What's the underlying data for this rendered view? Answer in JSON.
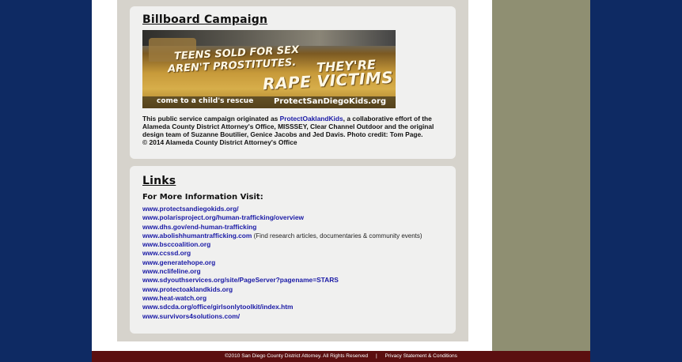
{
  "billboard": {
    "title": "Billboard Campaign",
    "image_text": {
      "line1": "TEENS SOLD FOR SEX",
      "line2": "AREN'T PROSTITUTES.",
      "line3": "THEY'RE",
      "line4": "RAPE VICTIMS",
      "strip_left": "come to a child's rescue",
      "strip_right": "ProtectSanDiegoKids.org"
    },
    "caption_prefix": "This public service campaign originated as ",
    "caption_link": "ProtectOaklandKids",
    "caption_suffix": ", a collaborative effort of the Alameda County District Attorney's Office, MISSSEY, Clear Channel Outdoor and the original design team of Suzanne Boutilier, Genice Jacobs and Jed Davis. Photo credit: Tom Page.",
    "caption_copyright": "© 2014 Alameda County District Attorney's Office"
  },
  "links": {
    "title": "Links",
    "subhead": "For More Information Visit:",
    "items": [
      {
        "label": "www.protectsandiegokids.org/"
      },
      {
        "label": "www.polarisproject.org/human-trafficking/overview"
      },
      {
        "label": "www.dhs.gov/end-human-trafficking"
      },
      {
        "label": "www.abolishhumantrafficking.com",
        "note": " (Find research articles, documentaries & community events)"
      },
      {
        "label": "www.bsccoalition.org"
      },
      {
        "label": "www.ccssd.org"
      },
      {
        "label": "www.generatehope.org"
      },
      {
        "label": "www.nclifeline.org"
      },
      {
        "label": "www.sdyouthservices.org/site/PageServer?pagename=STARS"
      },
      {
        "label": "www.protectoaklandkids.org"
      },
      {
        "label": "www.heat-watch.org"
      },
      {
        "label": "www.sdcda.org/office/girlsonlytoolkit/index.htm"
      },
      {
        "label": "www.survivors4solutions.com/"
      }
    ]
  },
  "footer": {
    "copyright": "©2010 San Diego County District Attorney. All Rights Reserved",
    "separator": "|",
    "privacy_link": "Privacy Statement & Conditions"
  }
}
